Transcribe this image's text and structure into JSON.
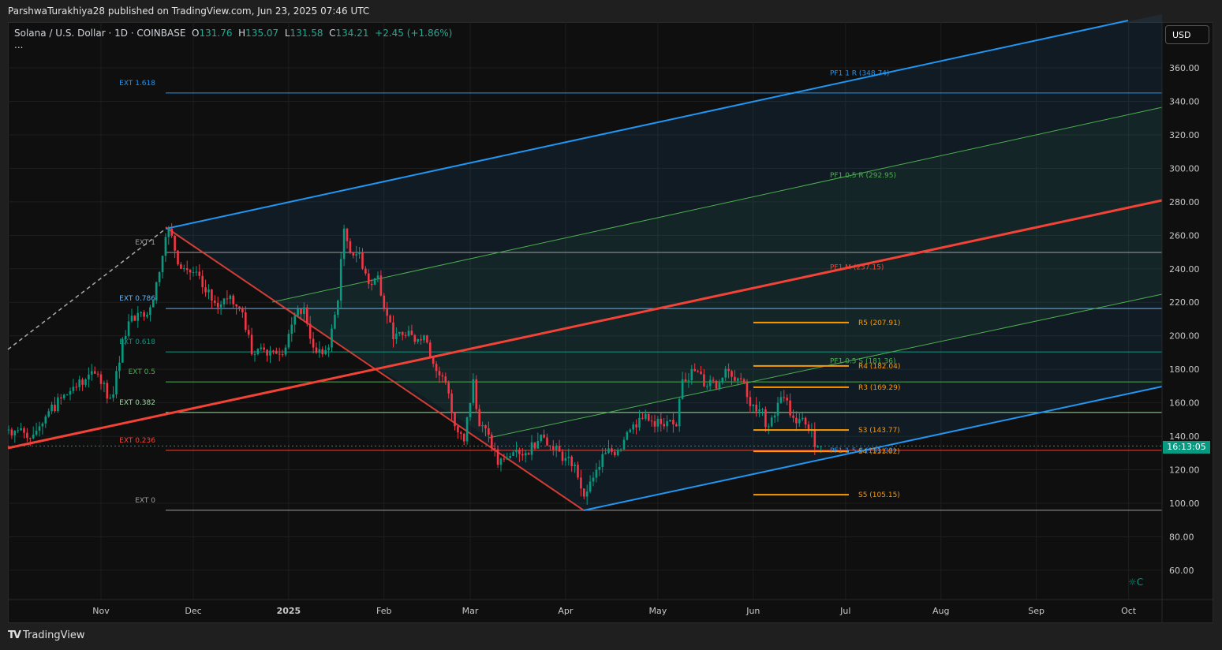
{
  "publisher": "ParshwaTurakhiya28 published on TradingView.com, Jun 23, 2025 07:46 UTC",
  "legend": {
    "symbol": "Solana / U.S. Dollar · 1D · COINBASE",
    "o_label": "O",
    "o": "131.76",
    "h_label": "H",
    "h": "135.07",
    "l_label": "L",
    "l": "131.58",
    "c_label": "C",
    "c": "134.21",
    "change": "+2.45 (+1.86%)",
    "more": "..."
  },
  "currency_button": "USD",
  "countdown": "16:13:05",
  "footer_brand": "TradingView",
  "colors": {
    "up": "#089981",
    "down": "#f23645",
    "pitchfork": "#2196f3",
    "median": "#f44336",
    "pivot": "#ff9800",
    "green": "#4caf50"
  },
  "chart_data": {
    "type": "candlestick",
    "title": "Solana / U.S. Dollar · 1D · COINBASE",
    "ylim": [
      50,
      375
    ],
    "yticks": [
      "60.00",
      "80.00",
      "100.00",
      "120.00",
      "140.00",
      "160.00",
      "180.00",
      "200.00",
      "220.00",
      "240.00",
      "260.00",
      "280.00",
      "300.00",
      "320.00",
      "340.00",
      "360.00"
    ],
    "xticks": [
      {
        "label": "Nov",
        "date": "2024-11-01"
      },
      {
        "label": "Dec",
        "date": "2024-12-01"
      },
      {
        "label": "2025",
        "date": "2025-01-01",
        "bold": true
      },
      {
        "label": "Feb",
        "date": "2025-02-01"
      },
      {
        "label": "Mar",
        "date": "2025-03-01"
      },
      {
        "label": "Apr",
        "date": "2025-04-01"
      },
      {
        "label": "May",
        "date": "2025-05-01"
      },
      {
        "label": "Jun",
        "date": "2025-06-01"
      },
      {
        "label": "Jul",
        "date": "2025-07-01"
      },
      {
        "label": "Aug",
        "date": "2025-08-01"
      },
      {
        "label": "Sep",
        "date": "2025-09-01"
      },
      {
        "label": "Oct",
        "date": "2025-10-01"
      }
    ],
    "close_anchors": [
      [
        "2024-10-02",
        144
      ],
      [
        "2024-10-10",
        141
      ],
      [
        "2024-10-15",
        155
      ],
      [
        "2024-10-22",
        167
      ],
      [
        "2024-10-27",
        174
      ],
      [
        "2024-10-31",
        177
      ],
      [
        "2024-11-04",
        163
      ],
      [
        "2024-11-05",
        165
      ],
      [
        "2024-11-08",
        198
      ],
      [
        "2024-11-11",
        212
      ],
      [
        "2024-11-14",
        214
      ],
      [
        "2024-11-17",
        217
      ],
      [
        "2024-11-20",
        238
      ],
      [
        "2024-11-22",
        259
      ],
      [
        "2024-11-23",
        264
      ],
      [
        "2024-11-27",
        240
      ],
      [
        "2024-12-01",
        238
      ],
      [
        "2024-12-05",
        226
      ],
      [
        "2024-12-09",
        217
      ],
      [
        "2024-12-13",
        224
      ],
      [
        "2024-12-17",
        214
      ],
      [
        "2024-12-20",
        189
      ],
      [
        "2024-12-23",
        193
      ],
      [
        "2024-12-27",
        191
      ],
      [
        "2024-12-31",
        193
      ],
      [
        "2025-01-03",
        212
      ],
      [
        "2025-01-06",
        217
      ],
      [
        "2025-01-09",
        193
      ],
      [
        "2025-01-12",
        189
      ],
      [
        "2025-01-14",
        193
      ],
      [
        "2025-01-17",
        221
      ],
      [
        "2025-01-19",
        264
      ],
      [
        "2025-01-21",
        250
      ],
      [
        "2025-01-24",
        250
      ],
      [
        "2025-01-27",
        231
      ],
      [
        "2025-01-30",
        236
      ],
      [
        "2025-02-02",
        212
      ],
      [
        "2025-02-04",
        198
      ],
      [
        "2025-02-08",
        200
      ],
      [
        "2025-02-12",
        198
      ],
      [
        "2025-02-15",
        196
      ],
      [
        "2025-02-18",
        179
      ],
      [
        "2025-02-21",
        172
      ],
      [
        "2025-02-24",
        146
      ],
      [
        "2025-02-27",
        137
      ],
      [
        "2025-03-02",
        174
      ],
      [
        "2025-03-04",
        146
      ],
      [
        "2025-03-07",
        141
      ],
      [
        "2025-03-10",
        123
      ],
      [
        "2025-03-13",
        127
      ],
      [
        "2025-03-16",
        132
      ],
      [
        "2025-03-19",
        130
      ],
      [
        "2025-03-24",
        141
      ],
      [
        "2025-03-28",
        132
      ],
      [
        "2025-04-01",
        127
      ],
      [
        "2025-04-04",
        123
      ],
      [
        "2025-04-07",
        104
      ],
      [
        "2025-04-09",
        113
      ],
      [
        "2025-04-11",
        120
      ],
      [
        "2025-04-14",
        130
      ],
      [
        "2025-04-18",
        132
      ],
      [
        "2025-04-22",
        144
      ],
      [
        "2025-04-25",
        151
      ],
      [
        "2025-04-29",
        149
      ],
      [
        "2025-05-03",
        146
      ],
      [
        "2025-05-07",
        146
      ],
      [
        "2025-05-09",
        174
      ],
      [
        "2025-05-13",
        179
      ],
      [
        "2025-05-17",
        170
      ],
      [
        "2025-05-21",
        172
      ],
      [
        "2025-05-24",
        179
      ],
      [
        "2025-05-28",
        174
      ],
      [
        "2025-05-31",
        158
      ],
      [
        "2025-06-03",
        156
      ],
      [
        "2025-06-06",
        146
      ],
      [
        "2025-06-09",
        160
      ],
      [
        "2025-06-11",
        163
      ],
      [
        "2025-06-14",
        151
      ],
      [
        "2025-06-17",
        151
      ],
      [
        "2025-06-19",
        144
      ],
      [
        "2025-06-22",
        134
      ],
      [
        "2025-06-23",
        134.21
      ]
    ],
    "last_price": 134.21,
    "fib_levels": [
      {
        "label": "EXT 1.618",
        "value": 345,
        "color": "#2196f3"
      },
      {
        "label": "EXT 1",
        "value": 249.8,
        "color": "#9e9e9e"
      },
      {
        "label": "EXT 0.786",
        "value": 216.3,
        "color": "#64b5f6"
      },
      {
        "label": "EXT 0.618",
        "value": 190.4,
        "color": "#089981"
      },
      {
        "label": "EXT 0.5",
        "value": 172.5,
        "color": "#4caf50"
      },
      {
        "label": "EXT 0.382",
        "value": 154.2,
        "color": "#a5d6a7"
      },
      {
        "label": "EXT 0.236",
        "value": 131.6,
        "color": "#f44336"
      },
      {
        "label": "EXT 0",
        "value": 95.8,
        "color": "#9e9e9e"
      }
    ],
    "pivots": [
      {
        "label": "R5 (207.91)",
        "value": 207.91
      },
      {
        "label": "R4 (182.04)",
        "value": 182.04
      },
      {
        "label": "R3 (169.29)",
        "value": 169.29
      },
      {
        "label": "S3 (143.77)",
        "value": 143.77
      },
      {
        "label": "S4 (131.02)",
        "value": 131.02
      },
      {
        "label": "S5 (105.15)",
        "value": 105.15
      }
    ],
    "pitchfork_labels": [
      {
        "label": "PF1 1 R (348.74)",
        "value": 357,
        "color": "#2196f3"
      },
      {
        "label": "PF1 0.5 R (292.95)",
        "value": 296,
        "color": "#4caf50"
      },
      {
        "label": "PF1 M (237.15)",
        "value": 241,
        "color": "#f44336"
      },
      {
        "label": "PF1 0.5 S (181.36)",
        "value": 185,
        "color": "#4caf50"
      },
      {
        "label": "PF1 1.5 S (131.02)",
        "value": 131.5,
        "color": "#2196f3"
      }
    ]
  }
}
